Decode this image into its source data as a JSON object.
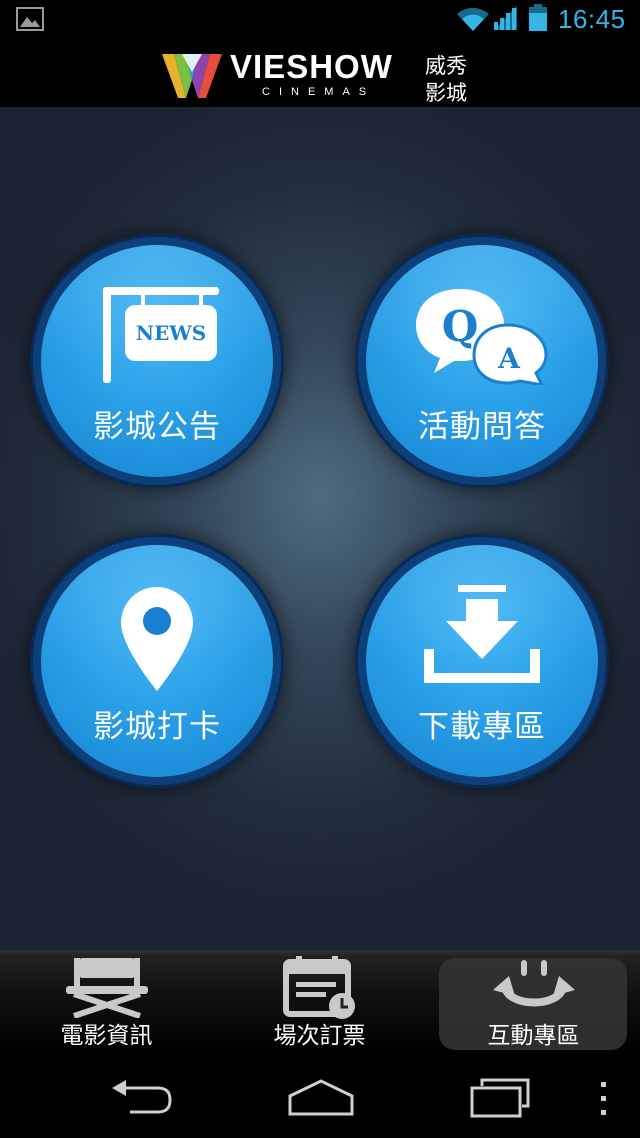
{
  "status_bar": {
    "time": "16:45",
    "accent": "#33b5e5"
  },
  "header": {
    "brand": "VIESHOW",
    "brand_sub": "CINEMAS",
    "brand_cn_line1": "威秀",
    "brand_cn_line2": "影城"
  },
  "menu": {
    "tiles": [
      {
        "label": "影城公告",
        "icon": "news-sign-icon",
        "icon_text": "NEWS"
      },
      {
        "label": "活動問答",
        "icon": "qa-bubbles-icon",
        "icon_text_q": "Q",
        "icon_text_a": "A"
      },
      {
        "label": "影城打卡",
        "icon": "location-pin-icon"
      },
      {
        "label": "下載專區",
        "icon": "download-tray-icon"
      }
    ],
    "circle_color": "#2aa1e8"
  },
  "tabbar": {
    "tabs": [
      {
        "label": "電影資訊",
        "icon": "director-chair-icon"
      },
      {
        "label": "場次訂票",
        "icon": "calendar-clock-icon"
      },
      {
        "label": "互動專區",
        "icon": "smiley-arrows-icon",
        "selected": true
      }
    ]
  },
  "system_nav": {
    "items": [
      "back-icon",
      "home-icon",
      "recent-apps-icon",
      "overflow-menu-icon"
    ]
  }
}
